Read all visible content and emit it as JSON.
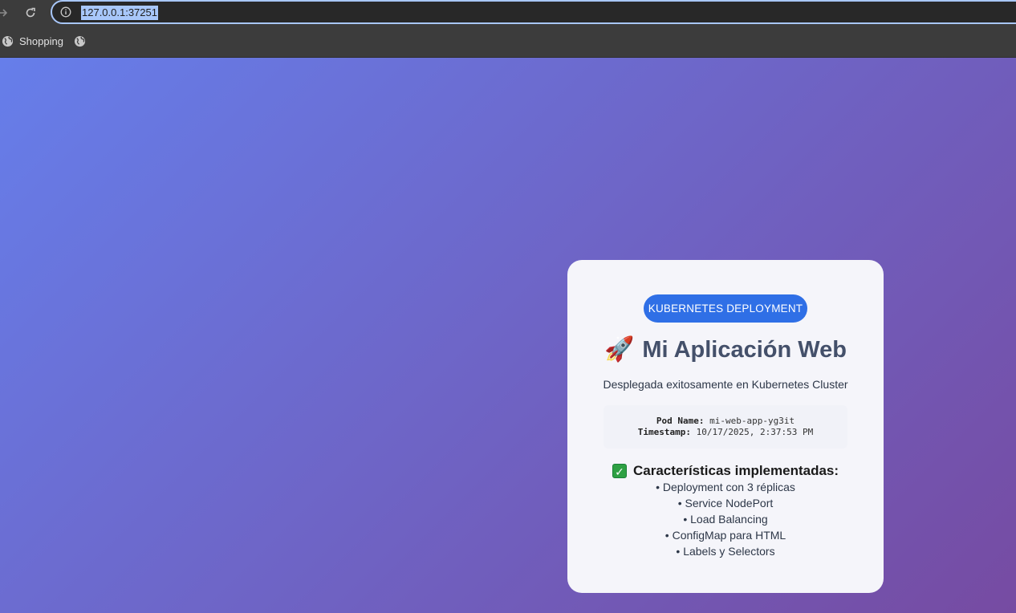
{
  "browser": {
    "url": "127.0.0.1:37251",
    "bookmarks": [
      {
        "label": "Shopping",
        "icon": "globe-icon"
      },
      {
        "label": "",
        "icon": "globe-icon"
      }
    ]
  },
  "page": {
    "badge": "KUBERNETES DEPLOYMENT",
    "title_emoji": "🚀",
    "title": "Mi Aplicación Web",
    "subtitle": "Desplegada exitosamente en Kubernetes Cluster",
    "pod_label": "Pod Name:",
    "pod_value": "mi-web-app-yg3it",
    "timestamp_label": "Timestamp:",
    "timestamp_value": "10/17/2025, 2:37:53 PM",
    "features_title": "Características implementadas:",
    "features": [
      "• Deployment con 3 réplicas",
      "• Service NodePort",
      "• Load Balancing",
      "• ConfigMap para HTML",
      "• Labels y Selectors"
    ]
  },
  "colors": {
    "gradient_start": "#667eea",
    "gradient_end": "#764ba2",
    "badge": "#2f6fe6",
    "card": "#f5f5fa"
  }
}
